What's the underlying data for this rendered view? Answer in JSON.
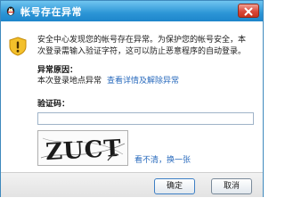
{
  "dialog": {
    "title": "帐号存在异常"
  },
  "message": {
    "line1": "安全中心发现您的帐号存在异常。为保护您的帐号安全，本",
    "line2": "次登录需输入验证字符，这可以防止恶意程序的自动登录。"
  },
  "reason": {
    "heading": "异常原因：",
    "text": "本次登录地点异常",
    "link": "查看详情及解除异常"
  },
  "captcha": {
    "label": "验证码：",
    "input_value": "",
    "image_text": "ZUCT",
    "refresh_link": "看不清，换一张"
  },
  "buttons": {
    "ok": "确定",
    "cancel": "取消"
  },
  "colors": {
    "title_bar": "#2c95d6",
    "link": "#2a6bbd",
    "warning": "#f3c02b"
  },
  "icons": {
    "title": "qq-penguin-icon",
    "warning": "warning-shield-icon",
    "close": "close-icon"
  }
}
